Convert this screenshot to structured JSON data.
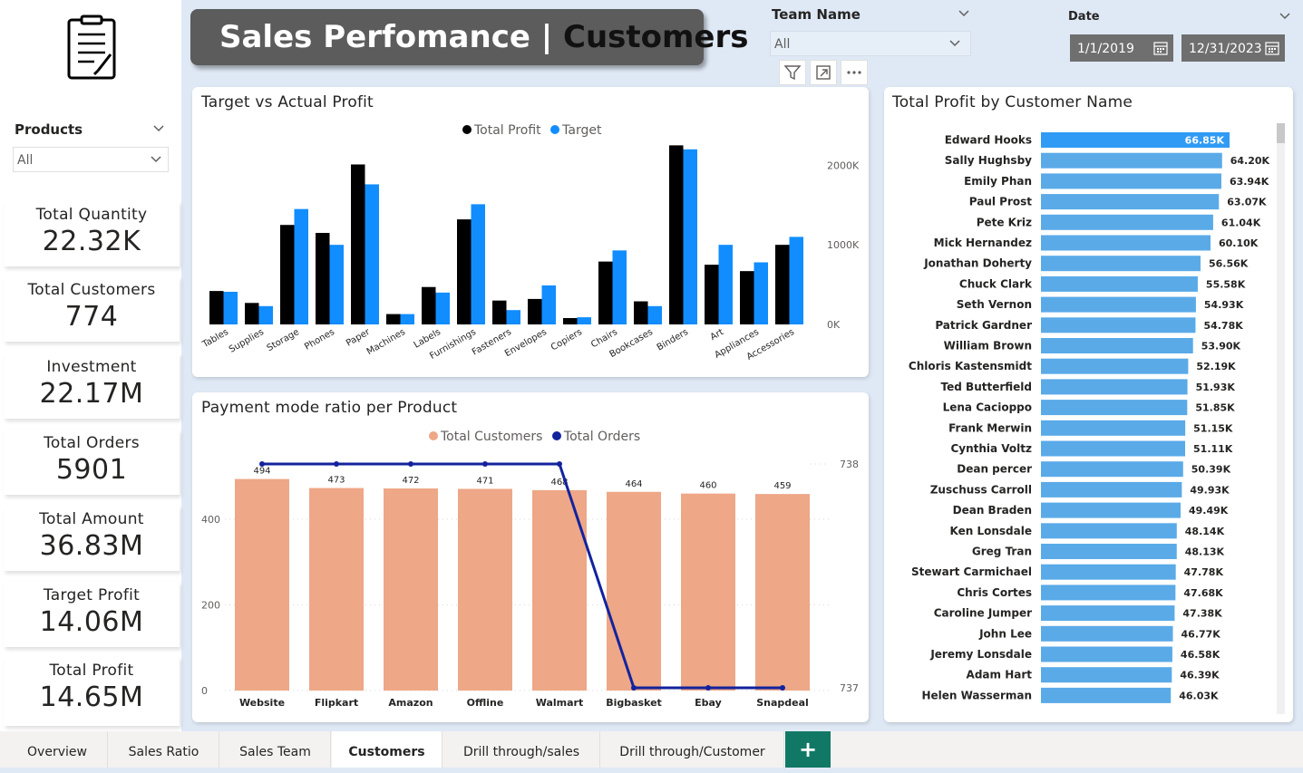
{
  "header": {
    "title_part1": "Sales Perfomance | ",
    "title_part2": "Customers"
  },
  "filters": {
    "products_label": "Products",
    "products_value": "All",
    "team_label": "Team Name",
    "team_value": "All",
    "date_label": "Date",
    "date_start": "1/1/2019",
    "date_end": "12/31/2023"
  },
  "kpis": [
    {
      "label": "Total Quantity",
      "value": "22.32K"
    },
    {
      "label": "Total Customers",
      "value": "774"
    },
    {
      "label": "Investment",
      "value": "22.17M"
    },
    {
      "label": "Total Orders",
      "value": "5901"
    },
    {
      "label": "Total Amount",
      "value": "36.83M"
    },
    {
      "label": "Target Profit",
      "value": "14.06M"
    },
    {
      "label": "Total Profit",
      "value": "14.65M"
    }
  ],
  "icons": {
    "logo": "clipboard-icon",
    "filter": "filter-icon",
    "focus": "focus-mode-icon",
    "more": "more-options-icon",
    "calendar": "calendar-icon",
    "chevron": "chevron-down-icon"
  },
  "colors": {
    "total_profit": "#000000",
    "target": "#118dff",
    "customers_bar": "#eea787",
    "orders_line": "#12239e",
    "customer_bar": "#5aaae8",
    "customer_bar_top": "#2f9bf4",
    "accent_tab": "#117865"
  },
  "tabs": [
    {
      "label": "Overview",
      "active": false
    },
    {
      "label": "Sales Ratio",
      "active": false
    },
    {
      "label": "Sales Team",
      "active": false
    },
    {
      "label": "Customers",
      "active": true
    },
    {
      "label": "Drill through/sales",
      "active": false
    },
    {
      "label": "Drill through/Customer",
      "active": false
    }
  ],
  "tab_add_label": "+",
  "chart_data": [
    {
      "id": "target-vs-actual",
      "type": "bar",
      "title": "Target vs Actual Profit",
      "legend": [
        "Total Profit",
        "Target"
      ],
      "categories": [
        "Tables",
        "Supplies",
        "Storage",
        "Phones",
        "Paper",
        "Machines",
        "Labels",
        "Furnishings",
        "Fasteners",
        "Envelopes",
        "Copiers",
        "Chairs",
        "Bookcases",
        "Binders",
        "Art",
        "Appliances",
        "Accessories"
      ],
      "series": [
        {
          "name": "Total Profit",
          "values": [
            420,
            270,
            1250,
            1150,
            2010,
            130,
            470,
            1320,
            300,
            320,
            80,
            790,
            290,
            2250,
            750,
            670,
            1000
          ]
        },
        {
          "name": "Target",
          "values": [
            410,
            230,
            1450,
            1000,
            1760,
            130,
            400,
            1510,
            180,
            490,
            90,
            930,
            230,
            2200,
            1000,
            780,
            1100
          ]
        }
      ],
      "y_ticks": [
        "0K",
        "1000K",
        "2000K"
      ],
      "ylim": [
        0,
        2300
      ],
      "y_unit": "K"
    },
    {
      "id": "payment-mode-ratio",
      "type": "bar+line",
      "title": "Payment mode ratio per Product",
      "legend": [
        "Total Customers",
        "Total Orders"
      ],
      "categories": [
        "Website",
        "Flipkart",
        "Amazon",
        "Offline",
        "Walmart",
        "Bigbasket",
        "Ebay",
        "Snapdeal"
      ],
      "series": [
        {
          "name": "Total Customers",
          "values": [
            494,
            473,
            472,
            471,
            468,
            464,
            460,
            459
          ]
        },
        {
          "name": "Total Orders",
          "values": [
            738,
            738,
            738,
            738,
            738,
            737,
            737,
            737
          ]
        }
      ],
      "bar_labels": [
        "494",
        "473",
        "472",
        "471",
        "468",
        "464",
        "460",
        "459"
      ],
      "y_left_ticks": [
        "0",
        "200",
        "400"
      ],
      "ylim_left": [
        0,
        530
      ],
      "y_right_ticks": [
        "737",
        "738"
      ],
      "ylim_right": [
        737,
        738
      ]
    },
    {
      "id": "profit-by-customer",
      "type": "bar",
      "orientation": "horizontal",
      "title": "Total Profit by Customer Name",
      "categories": [
        "Edward Hooks",
        "Sally Hughsby",
        "Emily Phan",
        "Paul Prost",
        "Pete Kriz",
        "Mick Hernandez",
        "Jonathan Doherty",
        "Chuck Clark",
        "Seth Vernon",
        "Patrick Gardner",
        "William Brown",
        "Chloris Kastensmidt",
        "Ted Butterfield",
        "Lena Cacioppo",
        "Frank Merwin",
        "Cynthia Voltz",
        "Dean percer",
        "Zuschuss Carroll",
        "Dean Braden",
        "Ken Lonsdale",
        "Greg Tran",
        "Stewart Carmichael",
        "Chris Cortes",
        "Caroline Jumper",
        "John Lee",
        "Jeremy Lonsdale",
        "Adam Hart",
        "Helen Wasserman"
      ],
      "values": [
        66.85,
        64.2,
        63.94,
        63.07,
        61.04,
        60.1,
        56.56,
        55.58,
        54.93,
        54.78,
        53.9,
        52.19,
        51.93,
        51.85,
        51.15,
        51.11,
        50.39,
        49.93,
        49.49,
        48.14,
        48.13,
        47.78,
        47.68,
        47.38,
        46.77,
        46.58,
        46.39,
        46.03
      ],
      "value_labels": [
        "66.85K",
        "64.20K",
        "63.94K",
        "63.07K",
        "61.04K",
        "60.10K",
        "56.56K",
        "55.58K",
        "54.93K",
        "54.78K",
        "53.90K",
        "52.19K",
        "51.93K",
        "51.85K",
        "51.15K",
        "51.11K",
        "50.39K",
        "49.93K",
        "49.49K",
        "48.14K",
        "48.13K",
        "47.78K",
        "47.68K",
        "47.38K",
        "46.77K",
        "46.58K",
        "46.39K",
        "46.03K"
      ],
      "unit": "K"
    }
  ]
}
